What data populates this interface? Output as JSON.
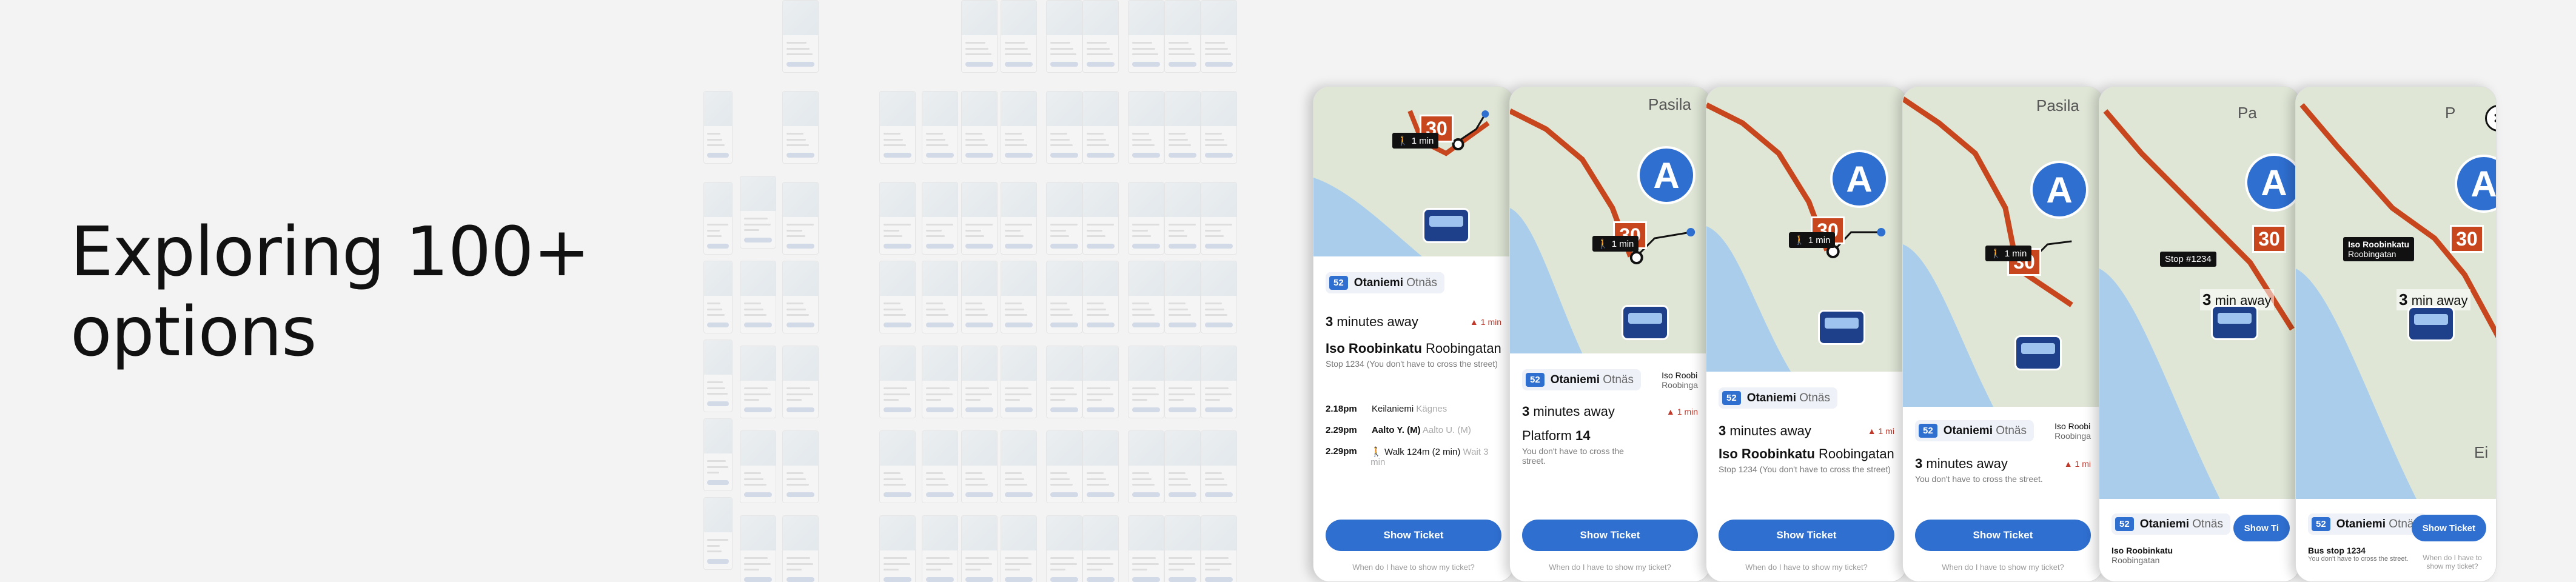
{
  "heading": {
    "line1": "Exploring 100+",
    "line2": "options"
  },
  "colors": {
    "accent": "#2f6fd0",
    "route": "#c8461d",
    "warning": "#c0392b",
    "bus": "#1e3f8a"
  },
  "phones": [
    {
      "line": "52",
      "dest_fi": "Otaniemi",
      "dest_sv": "Otnäs",
      "eta_num": "3",
      "eta_text": "minutes away",
      "warn": "1 min",
      "stop_fi": "Iso Roobinkatu",
      "stop_sv": "Roobingatan",
      "stop_sub": "Stop 1234 (You don't have to cross the street)",
      "route": [
        {
          "time": "2.18pm",
          "fi": "Keilaniemi",
          "sv": "Kägnes",
          "extra": ""
        },
        {
          "time": "2.29pm",
          "fi": "Aalto Y. (M)",
          "sv": "Aalto U. (M)",
          "extra": ""
        },
        {
          "time": "2.29pm",
          "fi": "Walk 124m (2 min)",
          "sv": "",
          "extra": "Wait 3 min"
        }
      ],
      "route_tag": "30",
      "walk": "1 min",
      "button": "Show Ticket",
      "link": "When do I have to show my ticket?"
    },
    {
      "line": "52",
      "dest_fi": "Otaniemi",
      "dest_sv": "Otnäs",
      "eta_num": "3",
      "eta_text": "minutes away",
      "warn": "1 min",
      "side_stop_fi": "Iso Roobi",
      "side_stop_sv": "Roobinga",
      "platform_label": "Platform",
      "platform_num": "14",
      "stop_sub": "You don't have to cross the street.",
      "map_label": "Pasila",
      "metro": "A",
      "route_tag": "30",
      "walk": "1 min",
      "button": "Show Ticket",
      "link": "When do I have to show my ticket?"
    },
    {
      "line": "52",
      "dest_fi": "Otaniemi",
      "dest_sv": "Otnäs",
      "eta_num": "3",
      "eta_text": "minutes away",
      "warn": "1 mi",
      "stop_fi": "Iso Roobinkatu",
      "stop_sv": "Roobingatan",
      "stop_sub": "Stop 1234 (You don't have to cross the street)",
      "metro": "A",
      "route_tag": "30",
      "walk": "1 min",
      "button": "Show Ticket",
      "link": "When do I have to show my ticket?"
    },
    {
      "line": "52",
      "dest_fi": "Otaniemi",
      "dest_sv": "Otnäs",
      "side_stop_fi": "Iso Roobi",
      "side_stop_sv": "Roobinga",
      "eta_num": "3",
      "eta_text": "minutes away",
      "warn": "1 mi",
      "stop_sub": "You don't have to cross the street.",
      "map_label": "Pasila",
      "metro": "A",
      "route_tag": "30",
      "walk": "1 min",
      "button": "Show Ticket",
      "link": "When do I have to show my ticket?"
    },
    {
      "line": "52",
      "dest_fi": "Otaniemi",
      "dest_sv": "Otnäs",
      "stop_fi": "Iso Roobinkatu",
      "stop_sv": "Roobingatan",
      "stop_ann": "Stop #1234",
      "eta_num": "3",
      "eta_text": "min away",
      "map_label": "Pa",
      "metro": "A",
      "route_tag": "30",
      "button": "Show Ti"
    },
    {
      "line": "52",
      "dest_fi": "Otaniemi",
      "dest_sv": "Otnäs",
      "stop_fi": "Bus stop 1234",
      "stop_sub": "You don't have to cross the street.",
      "stop_ann_fi": "Iso Roobinkatu",
      "stop_ann_sv": "Roobingatan",
      "eta_num": "3",
      "eta_text": "min away",
      "map_label": "P",
      "map_label2": "Ei",
      "metro": "A",
      "route_tag": "30",
      "button": "Show Ticket",
      "link": "When do I have to show my ticket?",
      "close": "×"
    }
  ]
}
